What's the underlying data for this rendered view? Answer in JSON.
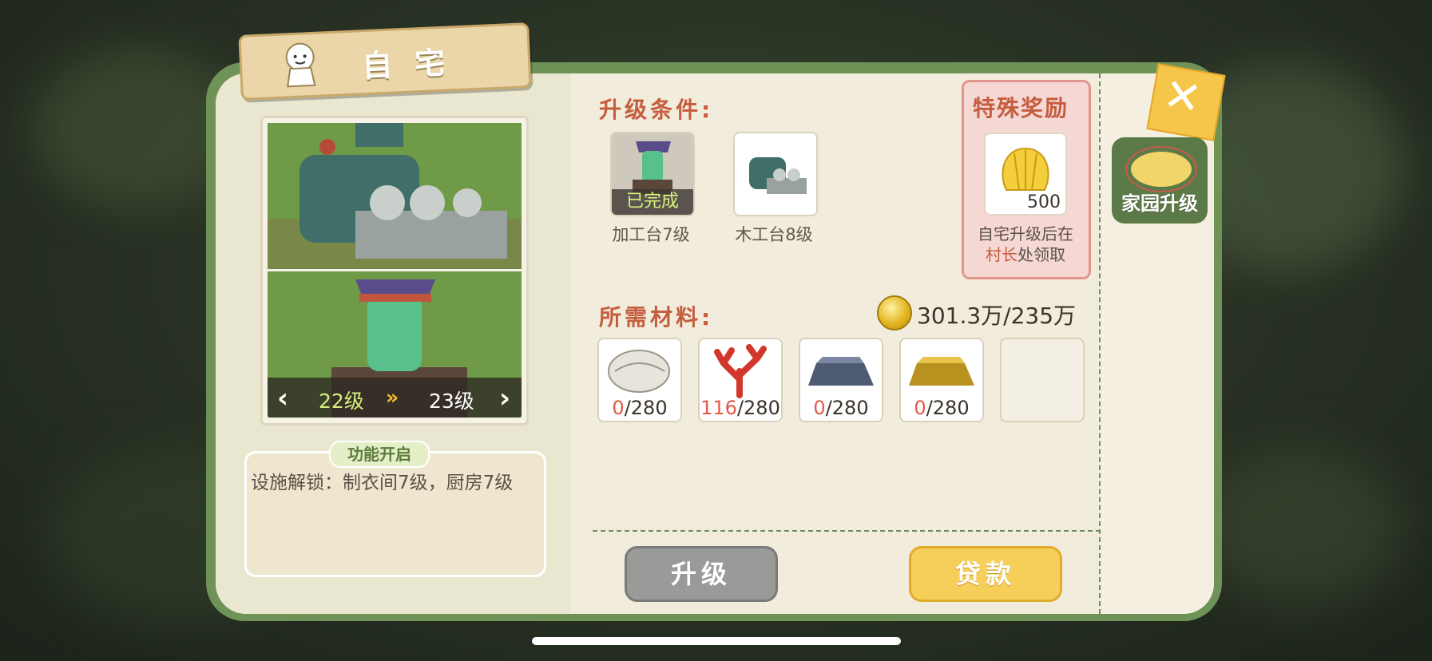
{
  "title": "自宅",
  "preview": {
    "level_current": "22级",
    "level_arrows": "»",
    "level_next": "23级",
    "nav_left": "‹",
    "nav_right": "›"
  },
  "function": {
    "label": "功能开启",
    "text": "设施解锁：制衣间7级，厨房7级"
  },
  "requirements": {
    "title": "升级条件:",
    "items": [
      {
        "label": "加工台7级",
        "status": "已完成"
      },
      {
        "label": "木工台8级",
        "status": ""
      }
    ]
  },
  "reward": {
    "title": "特殊奖励",
    "count": "500",
    "note_line1": "自宅升级后在",
    "note_highlight": "村长",
    "note_line2": "处领取"
  },
  "materials": {
    "title": "所需材料:",
    "coin_text": "301.3万/235万",
    "items": [
      {
        "name": "shell",
        "have": "0",
        "need": "/280"
      },
      {
        "name": "coral",
        "have": "116",
        "need": "/280"
      },
      {
        "name": "iron-ingot",
        "have": "0",
        "need": "/280"
      },
      {
        "name": "gold-ingot",
        "have": "0",
        "need": "/280"
      }
    ]
  },
  "buttons": {
    "upgrade": "升级",
    "loan": "贷款"
  },
  "side": {
    "home_upgrade": "家园升级",
    "close": "✕"
  },
  "colors": {
    "accent_title": "#c55d3f",
    "panel_green": "#6f9256",
    "loan_yellow": "#f6cf5a",
    "upgrade_gray": "#9a9a98"
  }
}
